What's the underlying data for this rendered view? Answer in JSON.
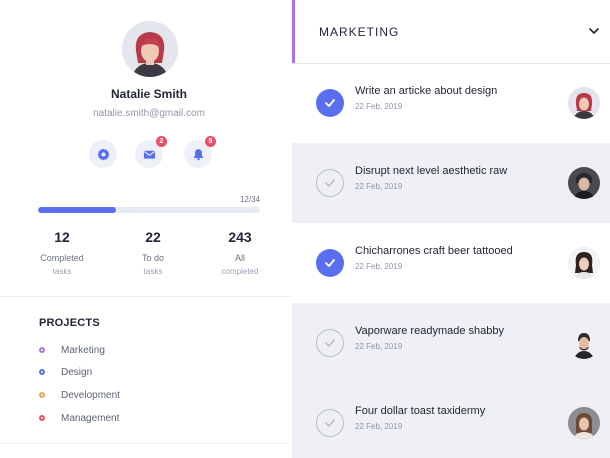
{
  "profile": {
    "name": "Natalie Smith",
    "email": "natalie.smith@gmail.com",
    "avatar_icon": "user-avatar-photo",
    "actions": [
      {
        "icon": "gear-icon",
        "badge": ""
      },
      {
        "icon": "mail-icon",
        "badge": "2"
      },
      {
        "icon": "bell-icon",
        "badge": "5"
      }
    ],
    "progress": {
      "label": "12/34",
      "completed": 12,
      "total": 34
    },
    "stats": [
      {
        "value": "12",
        "label": "Completed",
        "sublabel": "tasks"
      },
      {
        "value": "22",
        "label": "To do",
        "sublabel": "tasks"
      },
      {
        "value": "243",
        "label": "All",
        "sublabel": "completed"
      }
    ]
  },
  "projects": {
    "title": "PROJECTS",
    "items": [
      {
        "name": "Marketing",
        "color": "#a474e6"
      },
      {
        "name": "Design",
        "color": "#5a6ff0"
      },
      {
        "name": "Development",
        "color": "#f0a25a"
      },
      {
        "name": "Management",
        "color": "#ea4f68"
      }
    ]
  },
  "tasks_panel": {
    "title": "MARKETING",
    "accent_color": "#a474e6",
    "tasks": [
      {
        "title": "Write an articke about design",
        "date": "22 Feb, 2019",
        "done": true
      },
      {
        "title": "Disrupt next level aesthetic raw",
        "date": "22 Feb, 2019",
        "done": false
      },
      {
        "title": "Chicharrones craft beer tattooed",
        "date": "22 Feb, 2019",
        "done": true
      },
      {
        "title": "Vaporware readymade shabby",
        "date": "22 Feb, 2019",
        "done": false
      },
      {
        "title": "Four dollar toast taxidermy",
        "date": "22 Feb, 2019",
        "done": false
      }
    ]
  }
}
